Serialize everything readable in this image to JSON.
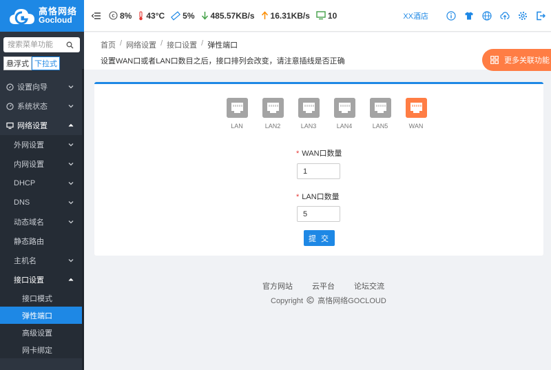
{
  "brand": {
    "name_cn": "高恪网络",
    "name_en": "Gocloud",
    "color": "#1e88e5"
  },
  "search": {
    "placeholder": "搜索菜单功能"
  },
  "menu_modes": [
    "悬浮式",
    "下拉式"
  ],
  "sidebar": {
    "items": [
      {
        "label": "设置向导"
      },
      {
        "label": "系统状态"
      },
      {
        "label": "网络设置"
      }
    ],
    "network_sub": [
      {
        "label": "外网设置"
      },
      {
        "label": "内网设置"
      },
      {
        "label": "DHCP"
      },
      {
        "label": "DNS"
      },
      {
        "label": "动态域名"
      },
      {
        "label": "静态路由"
      },
      {
        "label": "主机名"
      },
      {
        "label": "接口设置"
      }
    ],
    "interface_sub": [
      {
        "label": "接口模式"
      },
      {
        "label": "弹性端口"
      },
      {
        "label": "高级设置"
      },
      {
        "label": "网卡绑定"
      }
    ]
  },
  "topbar": {
    "cpu": "8%",
    "temp": "43°C",
    "memory": "5%",
    "download": "485.57KB/s",
    "upload": "16.31KB/s",
    "devices": "10",
    "store": "XX酒店"
  },
  "breadcrumb": {
    "home": "首页",
    "level1": "网络设置",
    "level2": "接口设置",
    "current": "弹性端口"
  },
  "description": "设置WAN口或者LAN口数目之后，接口排列会改变，请注意插线是否正确",
  "more_button": "更多关联功能",
  "ports": [
    {
      "label": "LAN"
    },
    {
      "label": "LAN2"
    },
    {
      "label": "LAN3"
    },
    {
      "label": "LAN4"
    },
    {
      "label": "LAN5"
    },
    {
      "label": "WAN"
    }
  ],
  "form": {
    "wan_label": "WAN口数量",
    "wan_value": "1",
    "lan_label": "LAN口数量",
    "lan_value": "5",
    "submit": "提 交"
  },
  "footer": {
    "links": [
      "官方网站",
      "云平台",
      "论坛交流"
    ],
    "copyright": "Copyright",
    "company": "高恪网络GOCLOUD"
  },
  "colors": {
    "accent": "#1e88e5",
    "wan": "#ff7d44",
    "lan": "#a4a4a4",
    "sidebar": "#2d3540"
  }
}
